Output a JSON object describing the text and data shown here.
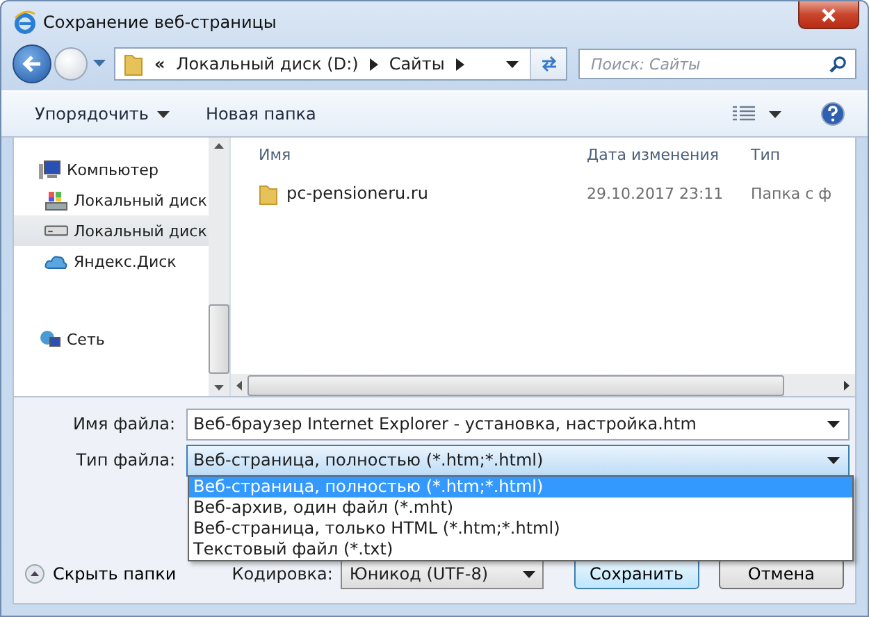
{
  "window": {
    "title": "Сохранение веб-страницы"
  },
  "address": {
    "prefix": "«",
    "crumbs": [
      "Локальный диск (D:)",
      "Сайты"
    ]
  },
  "search": {
    "placeholder": "Поиск: Сайты"
  },
  "toolbar": {
    "organize": "Упорядочить",
    "new_folder": "Новая папка"
  },
  "sidebar": {
    "items": [
      {
        "label": "Компьютер",
        "kind": "computer",
        "selected": false,
        "children": [
          {
            "label": "Локальный диск",
            "kind": "system-drive",
            "selected": false
          },
          {
            "label": "Локальный диск",
            "kind": "drive",
            "selected": true
          },
          {
            "label": "Яндекс.Диск",
            "kind": "cloud",
            "selected": false
          }
        ]
      },
      {
        "label": "Сеть",
        "kind": "network",
        "selected": false
      }
    ]
  },
  "table": {
    "columns": [
      "Имя",
      "Дата изменения",
      "Тип"
    ],
    "rows": [
      {
        "name": "pc-pensioneru.ru",
        "date": "29.10.2017 23:11",
        "type": "Папка с ф"
      }
    ]
  },
  "form": {
    "filename_label": "Имя файла:",
    "filename": "Веб-браузер Internet Explorer - установка, настройка.htm",
    "type_label": "Тип файла:",
    "type_value": "Веб-страница, полностью (*.htm;*.html)",
    "type_expanded": true,
    "type_options": [
      {
        "label": "Веб-страница, полностью (*.htm;*.html)",
        "selected": true
      },
      {
        "label": "Веб-архив, один файл (*.mht)",
        "selected": false
      },
      {
        "label": "Веб-страница, только HTML (*.htm;*.html)",
        "selected": false
      },
      {
        "label": "Текстовый файл (*.txt)",
        "selected": false
      }
    ]
  },
  "footer": {
    "hide_folders": "Скрыть папки",
    "encoding_label": "Кодировка:",
    "encoding": "Юникод (UTF-8)",
    "save": "Сохранить",
    "cancel": "Отмена"
  }
}
